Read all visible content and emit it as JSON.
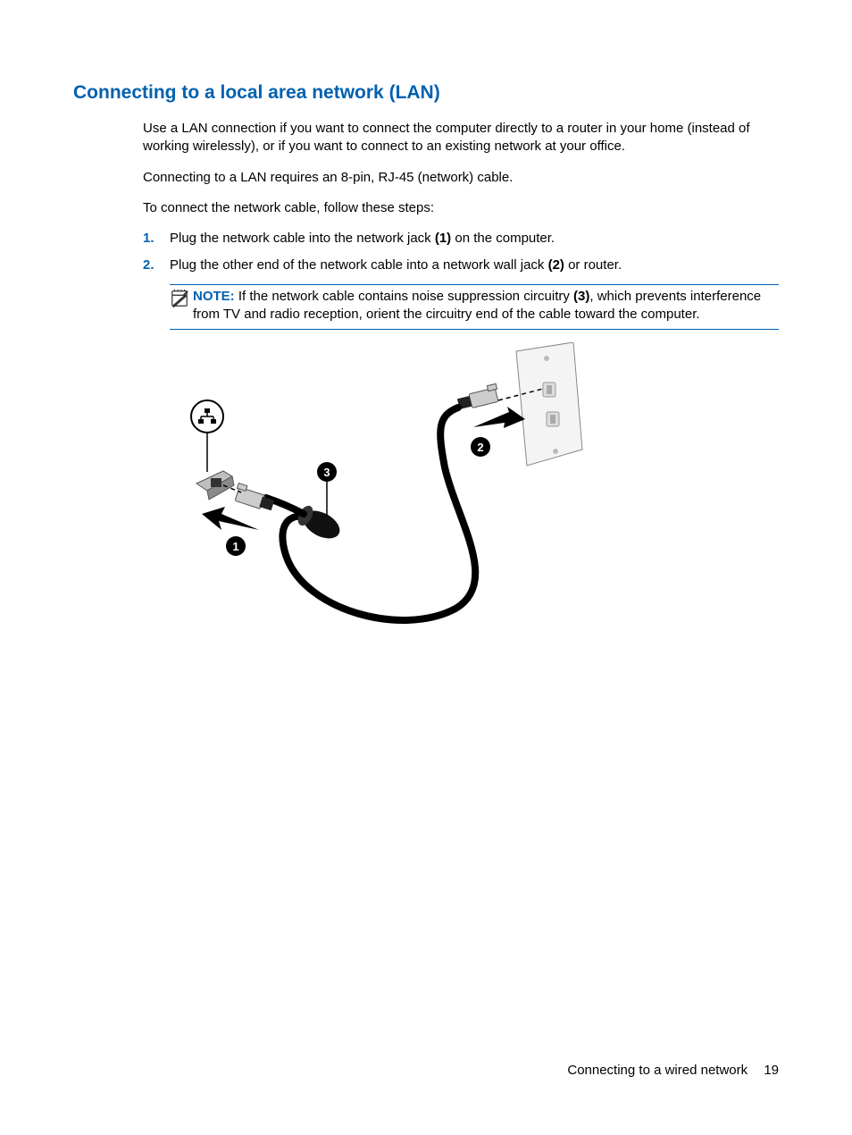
{
  "heading": "Connecting to a local area network (LAN)",
  "para1": "Use a LAN connection if you want to connect the computer directly to a router in your home (instead of working wirelessly), or if you want to connect to an existing network at your office.",
  "para2": "Connecting to a LAN requires an 8-pin, RJ-45 (network) cable.",
  "para3": "To connect the network cable, follow these steps:",
  "steps": [
    {
      "num": "1.",
      "pre": "Plug the network cable into the network jack ",
      "bold": "(1)",
      "post": " on the computer."
    },
    {
      "num": "2.",
      "pre": "Plug the other end of the network cable into a network wall jack ",
      "bold": "(2)",
      "post": " or router."
    }
  ],
  "note": {
    "label": "NOTE:",
    "pre": "   If the network cable contains noise suppression circuitry ",
    "bold": "(3)",
    "post": ", which prevents interference from TV and radio reception, orient the circuitry end of the cable toward the computer."
  },
  "footer": {
    "title": "Connecting to a wired network",
    "page": "19"
  }
}
